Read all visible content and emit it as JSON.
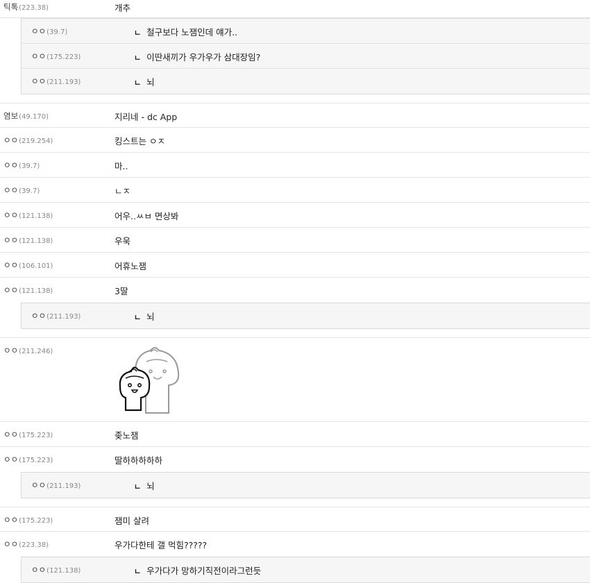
{
  "reply_marker": "ㄴ",
  "top_replies": [
    {
      "nick": "ㅇㅇ",
      "ip": "(39.7)",
      "text": "철구보다 노잼인데 얘가.."
    },
    {
      "nick": "ㅇㅇ",
      "ip": "(175.223)",
      "text": "이딴새끼가 우가우가 삼대장임?"
    },
    {
      "nick": "ㅇㅇ",
      "ip": "(211.193)",
      "text": "뇌"
    }
  ],
  "first_comment": {
    "nick": "틱톡",
    "ip": "(223.38)",
    "text": "개추"
  },
  "comments_a": [
    {
      "nick": "염보",
      "ip": "(49.170)",
      "text": "지리네 - dc App"
    },
    {
      "nick": "ㅇㅇ",
      "ip": "(219.254)",
      "text": "킹스트는 ㅇㅈ"
    },
    {
      "nick": "ㅇㅇ",
      "ip": "(39.7)",
      "text": "마.."
    },
    {
      "nick": "ㅇㅇ",
      "ip": "(39.7)",
      "text": "ㄴㅈ"
    },
    {
      "nick": "ㅇㅇ",
      "ip": "(121.138)",
      "text": "어우..ㅆㅂ 면상봐"
    },
    {
      "nick": "ㅇㅇ",
      "ip": "(121.138)",
      "text": "우욱"
    },
    {
      "nick": "ㅇㅇ",
      "ip": "(106.101)",
      "text": "어휴노잼"
    },
    {
      "nick": "ㅇㅇ",
      "ip": "(121.138)",
      "text": "3딸"
    }
  ],
  "reply_b": {
    "nick": "ㅇㅇ",
    "ip": "(211.193)",
    "text": "뇌"
  },
  "image_comment": {
    "nick": "ㅇㅇ",
    "ip": "(211.246)",
    "icon": "dumpling-sticker-icon"
  },
  "comments_c": [
    {
      "nick": "ㅇㅇ",
      "ip": "(175.223)",
      "text": "좆노잼"
    },
    {
      "nick": "ㅇㅇ",
      "ip": "(175.223)",
      "text": "딸하하하하하"
    }
  ],
  "reply_c": {
    "nick": "ㅇㅇ",
    "ip": "(211.193)",
    "text": "뇌"
  },
  "comments_d": [
    {
      "nick": "ㅇㅇ",
      "ip": "(175.223)",
      "text": "잼미 살려"
    },
    {
      "nick": "ㅇㅇ",
      "ip": "(223.38)",
      "text": "우가다한테 갤 먹힘?????"
    }
  ],
  "reply_d": {
    "nick": "ㅇㅇ",
    "ip": "(121.138)",
    "text": "우가다가 망하기직전이라그런듯"
  }
}
